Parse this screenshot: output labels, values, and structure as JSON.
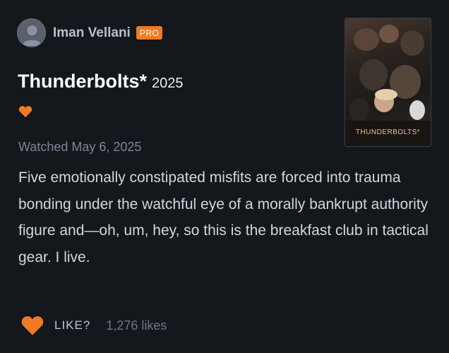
{
  "author": {
    "name": "Iman Vellani",
    "badge": "PRO"
  },
  "film": {
    "title": "Thunderbolts*",
    "year": "2025",
    "poster_title": "THUNDERBOLTS*"
  },
  "review": {
    "watched": "Watched May 6, 2025",
    "text": "Five emotionally constipated misfits are forced into trauma bonding under the watchful eye of a morally bankrupt authority figure and—oh, um, hey, so this is the breakfast club in tactical gear. I live.",
    "liked_icon": "heart-icon"
  },
  "actions": {
    "like_label": "LIKE?",
    "like_count": "1,276 likes"
  },
  "colors": {
    "accent": "#f27a24",
    "background": "#14171c"
  }
}
